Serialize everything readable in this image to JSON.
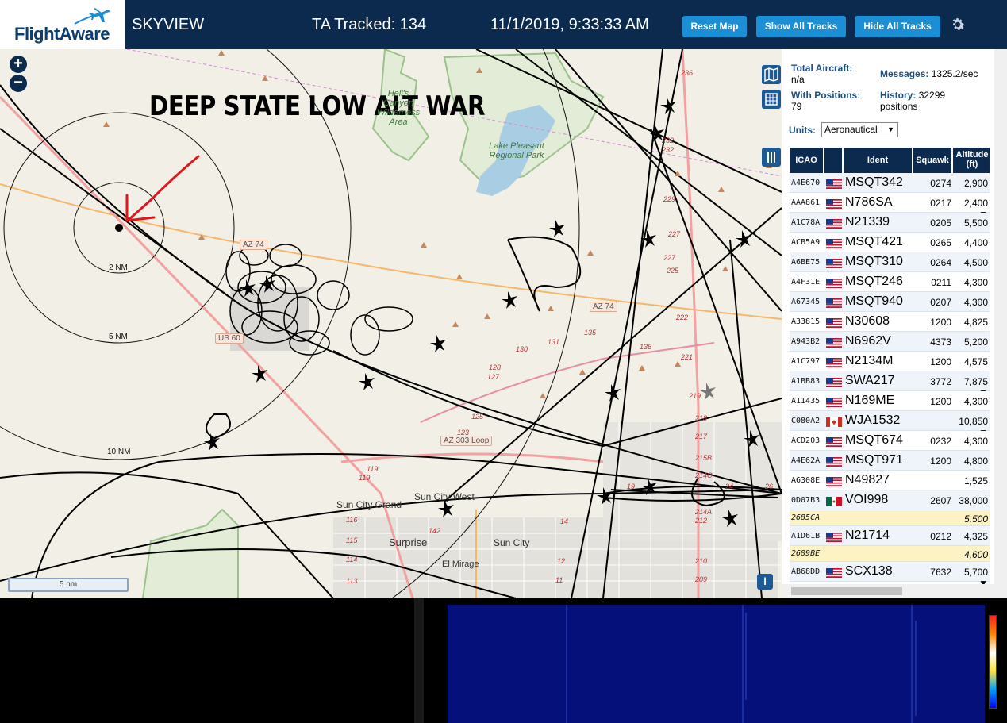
{
  "header": {
    "logo_text": "FlightAware",
    "app_name": "SKYVIEW",
    "tracked": "TA Tracked: 134",
    "datetime": "11/1/2019, 9:33:33 AM",
    "buttons": {
      "reset_map": "Reset Map",
      "show_all": "Show All Tracks",
      "hide_all": "Hide All Tracks"
    }
  },
  "map": {
    "overlay_title": "DEEP STATE LOW ALT WAR",
    "zoom_in": "+",
    "zoom_out": "−",
    "scale": "5 nm",
    "info": "i",
    "range_rings": [
      "2 NM",
      "5 NM",
      "10 NM"
    ],
    "road_shields": [
      "AZ 74",
      "AZ 74",
      "US 60",
      "AZ 303 Loop"
    ],
    "parks": [
      "Hell's Canyon Wilderness Area",
      "Lake Pleasant Regional Park"
    ],
    "cities": [
      "Sun City Grand",
      "Sun City West",
      "Sun City",
      "Surprise",
      "El Mirage"
    ],
    "mileposts": [
      "236",
      "232",
      "232",
      "229",
      "227",
      "227",
      "225",
      "222",
      "221",
      "219",
      "218",
      "217",
      "215B",
      "214C",
      "214A",
      "212",
      "210",
      "209",
      "131",
      "130",
      "135",
      "136",
      "128",
      "127",
      "125",
      "123",
      "119",
      "119",
      "116",
      "115",
      "114",
      "113",
      "142",
      "14",
      "12",
      "11",
      "19",
      "24",
      "26"
    ]
  },
  "panel": {
    "total_aircraft_label": "Total Aircraft:",
    "total_aircraft_value": "n/a",
    "messages_label": "Messages:",
    "messages_value": "1325.2/sec",
    "with_positions_label": "With Positions:",
    "with_positions_value": "79",
    "history_label": "History:",
    "history_value": "32299 positions",
    "units_label": "Units:",
    "units_value": "Aeronautical",
    "columns": {
      "icao": "ICAO",
      "ident": "Ident",
      "squawk": "Squawk",
      "altitude": "Altitude (ft)"
    },
    "rows": [
      {
        "icao": "A4E670",
        "flag": "us",
        "ident": "MSQT342",
        "squawk": "0274",
        "alt": "2,900"
      },
      {
        "icao": "AAA861",
        "flag": "us",
        "ident": "N786SA",
        "squawk": "0217",
        "alt": "2,400 ▼"
      },
      {
        "icao": "A1C78A",
        "flag": "us",
        "ident": "N21339",
        "squawk": "0205",
        "alt": "5,500"
      },
      {
        "icao": "ACB5A9",
        "flag": "us",
        "ident": "MSQT421",
        "squawk": "0265",
        "alt": "4,400"
      },
      {
        "icao": "A6BE75",
        "flag": "us",
        "ident": "MSQT310",
        "squawk": "0264",
        "alt": "4,500"
      },
      {
        "icao": "A4F31E",
        "flag": "us",
        "ident": "MSQT246",
        "squawk": "0211",
        "alt": "4,300"
      },
      {
        "icao": "A67345",
        "flag": "us",
        "ident": "MSQT940",
        "squawk": "0207",
        "alt": "4,300"
      },
      {
        "icao": "A33815",
        "flag": "us",
        "ident": "N30608",
        "squawk": "1200",
        "alt": "4,825"
      },
      {
        "icao": "A943B2",
        "flag": "us",
        "ident": "N6962V",
        "squawk": "4373",
        "alt": "5,200"
      },
      {
        "icao": "A1C797",
        "flag": "us",
        "ident": "N2134M",
        "squawk": "1200",
        "alt": "4,575 ▲"
      },
      {
        "icao": "A1BB83",
        "flag": "us",
        "ident": "SWA217",
        "squawk": "3772",
        "alt": "7,875 ▼"
      },
      {
        "icao": "A11435",
        "flag": "us",
        "ident": "N169ME",
        "squawk": "1200",
        "alt": "4,300"
      },
      {
        "icao": "C080A2",
        "flag": "ca",
        "ident": "WJA1532",
        "squawk": "",
        "alt": "10,850 ▼"
      },
      {
        "icao": "ACD203",
        "flag": "us",
        "ident": "MSQT674",
        "squawk": "0232",
        "alt": "4,300"
      },
      {
        "icao": "A4E62A",
        "flag": "us",
        "ident": "MSQT971",
        "squawk": "1200",
        "alt": "4,800"
      },
      {
        "icao": "A6308E",
        "flag": "us",
        "ident": "N49827",
        "squawk": "",
        "alt": "1,525 ▲"
      },
      {
        "icao": "0D07B3",
        "flag": "mx",
        "ident": "VOI998",
        "squawk": "2607",
        "alt": "38,000"
      },
      {
        "icao": "2685CA",
        "flag": "",
        "ident": "",
        "squawk": "",
        "alt": "5,500 ▲"
      },
      {
        "icao": "A1D61B",
        "flag": "us",
        "ident": "N21714",
        "squawk": "0212",
        "alt": "4,325"
      },
      {
        "icao": "2689BE",
        "flag": "",
        "ident": "",
        "squawk": "",
        "alt": "4,600 ▲"
      },
      {
        "icao": "AB68DD",
        "flag": "us",
        "ident": "SCX138",
        "squawk": "7632",
        "alt": "5,700 ▼"
      }
    ]
  },
  "icons": {
    "gear": "gear-icon",
    "map_layers": "map-icon",
    "grid": "grid-icon",
    "columns": "columns-icon"
  },
  "colors": {
    "header_bg": "#0b2a4e",
    "button": "#1a8fd6",
    "map_bg": "#f1efe6",
    "track": "#000000",
    "annotation": "#e0161c",
    "waterfall": "#05107a"
  }
}
